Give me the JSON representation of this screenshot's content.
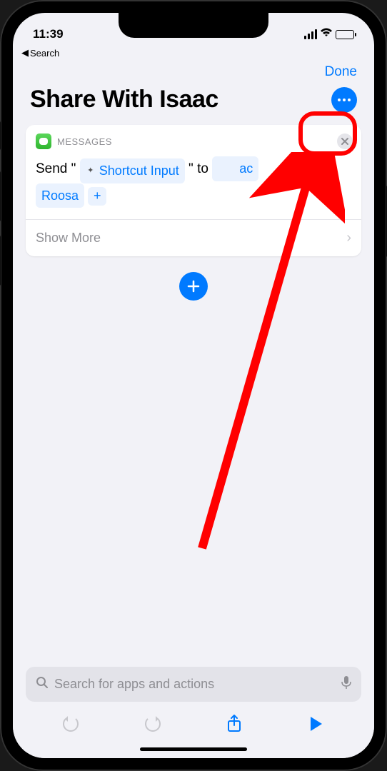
{
  "status": {
    "time": "11:39",
    "back_label": "Search"
  },
  "nav": {
    "done_label": "Done"
  },
  "header": {
    "title": "Share With Isaac"
  },
  "action_card": {
    "app_label": "MESSAGES",
    "send_prefix": "Send \"",
    "input_token": "Shortcut Input",
    "send_mid": "\" to",
    "recipient_partial_before": "ac",
    "recipient_line2": "Roosa",
    "show_more_label": "Show More"
  },
  "search": {
    "placeholder": "Search for apps and actions"
  },
  "annotation": {
    "type": "callout",
    "target": "more-options-button",
    "style": "red-circle-arrow"
  }
}
